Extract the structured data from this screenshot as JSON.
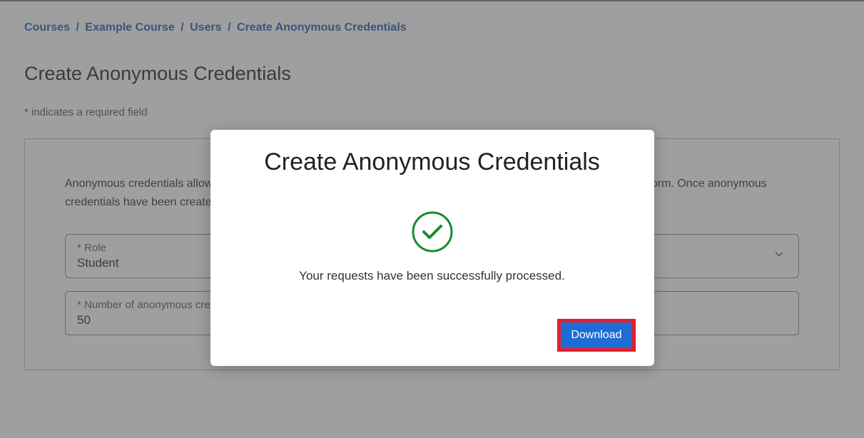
{
  "breadcrumb": {
    "items": [
      "Courses",
      "Example Course",
      "Users",
      "Create Anonymous Credentials"
    ]
  },
  "page": {
    "title": "Create Anonymous Credentials",
    "required_note": "* indicates a required field",
    "intro": "Anonymous credentials allow you to enroll users without sharing any personally identifiable information with our platform. Once anonymous credentials have been created, you may distribute them to students or TAs at your preferred time and method."
  },
  "form": {
    "role": {
      "label": "Role",
      "value": "Student"
    },
    "count": {
      "label": "Number of anonymous credentials needed",
      "value": "50"
    }
  },
  "modal": {
    "title": "Create Anonymous Credentials",
    "message": "Your requests have been successfully processed.",
    "download_label": "Download"
  }
}
